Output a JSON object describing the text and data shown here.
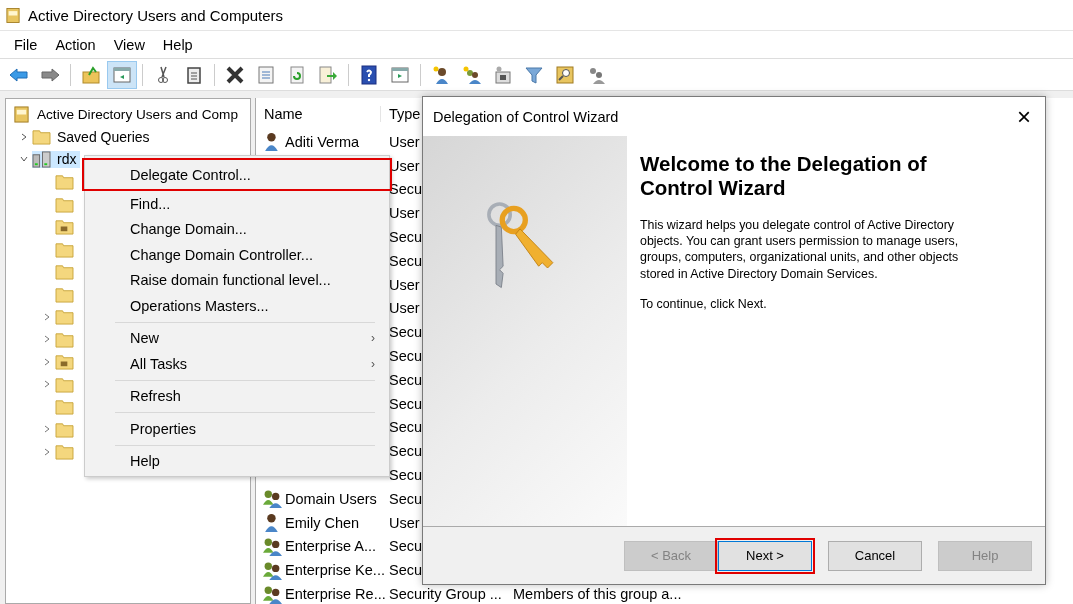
{
  "window": {
    "title": "Active Directory Users and Computers"
  },
  "menu_bar": [
    "File",
    "Action",
    "View",
    "Help"
  ],
  "toolbar": {
    "console_tree_pressed": true
  },
  "tree": [
    {
      "label": "Active Directory Users and Comp",
      "kind": "root",
      "selected": false,
      "children": [
        {
          "label": "Saved Queries",
          "kind": "folder",
          "expandable": true,
          "expanded": false,
          "selected": false
        },
        {
          "label": "rdx",
          "kind": "domain",
          "expandable": true,
          "expanded": true,
          "selected": true,
          "children": [
            {
              "kind": "folder",
              "expandable": false
            },
            {
              "kind": "folder",
              "expandable": false
            },
            {
              "kind": "special",
              "expandable": false
            },
            {
              "kind": "folder",
              "expandable": false
            },
            {
              "kind": "folder",
              "expandable": false
            },
            {
              "kind": "folder",
              "expandable": false
            },
            {
              "kind": "folder",
              "expandable": true
            },
            {
              "kind": "folder",
              "expandable": true
            },
            {
              "kind": "special",
              "expandable": true
            },
            {
              "kind": "folder",
              "expandable": true
            },
            {
              "kind": "folder",
              "expandable": false
            },
            {
              "kind": "folder",
              "expandable": true
            },
            {
              "kind": "folder",
              "expandable": true
            }
          ]
        }
      ]
    }
  ],
  "list": {
    "columns": [
      "Name",
      "Type"
    ],
    "rows": [
      {
        "name": "Aditi Verma",
        "kind": "user",
        "type": "User"
      },
      {
        "type": "User"
      },
      {
        "type": "Secu"
      },
      {
        "type": "User"
      },
      {
        "type": "Secu"
      },
      {
        "type": "Secu"
      },
      {
        "type": "User"
      },
      {
        "type": "User"
      },
      {
        "type": "Secu"
      },
      {
        "type": "Secu"
      },
      {
        "type": "Secu"
      },
      {
        "type": "Secu"
      },
      {
        "type": "Secu"
      },
      {
        "type": "Secu"
      },
      {
        "type": "Secu"
      },
      {
        "name": "Domain Users",
        "kind": "group",
        "type": "Secu"
      },
      {
        "name": "Emily Chen",
        "kind": "user",
        "type": "User"
      },
      {
        "name": "Enterprise A...",
        "kind": "group",
        "type": "Secu"
      },
      {
        "name": "Enterprise Ke...",
        "kind": "group",
        "type": "Secu"
      },
      {
        "name": "Enterprise Re...",
        "kind": "group",
        "type": "Security Group ...",
        "description": "Members of this group a..."
      }
    ]
  },
  "context_menu": {
    "groups": [
      [
        {
          "label": "Delegate Control...",
          "highlighted": true
        },
        {
          "label": "Find...",
          "highlighted": false
        },
        {
          "label": "Change Domain...",
          "highlighted": false
        },
        {
          "label": "Change Domain Controller...",
          "highlighted": false
        },
        {
          "label": "Raise domain functional level...",
          "highlighted": false
        },
        {
          "label": "Operations Masters...",
          "highlighted": false
        }
      ],
      [
        {
          "label": "New",
          "submenu": "›",
          "highlighted": false
        },
        {
          "label": "All Tasks",
          "submenu": "›",
          "highlighted": false
        }
      ],
      [
        {
          "label": "Refresh",
          "highlighted": false
        }
      ],
      [
        {
          "label": "Properties",
          "highlighted": false
        }
      ],
      [
        {
          "label": "Help",
          "highlighted": false
        }
      ]
    ]
  },
  "dialog": {
    "title": "Delegation of Control Wizard",
    "close": "×",
    "heading": "Welcome to the Delegation of Control Wizard",
    "paragraphs": [
      "This wizard helps you delegate control of Active Directory objects. You can grant users permission to manage users, groups, computers, organizational units, and other objects stored in Active Directory Domain Services.",
      "To continue, click Next."
    ],
    "buttons": [
      {
        "label": "< Back",
        "disabled": true,
        "highlighted": false
      },
      {
        "label": "Next >",
        "disabled": false,
        "highlighted": true
      },
      {
        "label": "Cancel",
        "disabled": false,
        "highlighted": false
      },
      {
        "label": "Help",
        "disabled": true,
        "highlighted": false
      }
    ]
  }
}
